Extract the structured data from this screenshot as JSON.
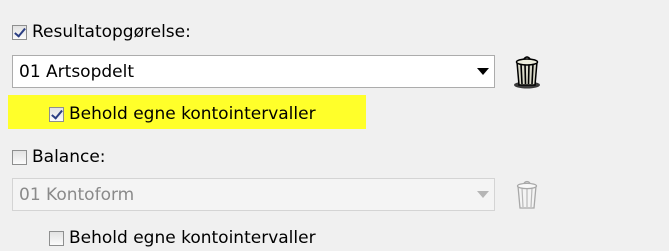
{
  "resultat": {
    "label": "Resultatopgørelse:",
    "checked": true,
    "dropdown_value": "01 Artsopdelt",
    "keep_label": "Behold egne kontointervaller",
    "keep_checked": true,
    "highlight_color": "#ffff2a"
  },
  "balance": {
    "label": "Balance:",
    "checked": false,
    "dropdown_value": "01 Kontoform",
    "keep_label": "Behold egne kontointervaller",
    "keep_checked": false
  },
  "icons": {
    "delete_active": "trash-can-icon",
    "delete_disabled": "trash-can-icon"
  }
}
